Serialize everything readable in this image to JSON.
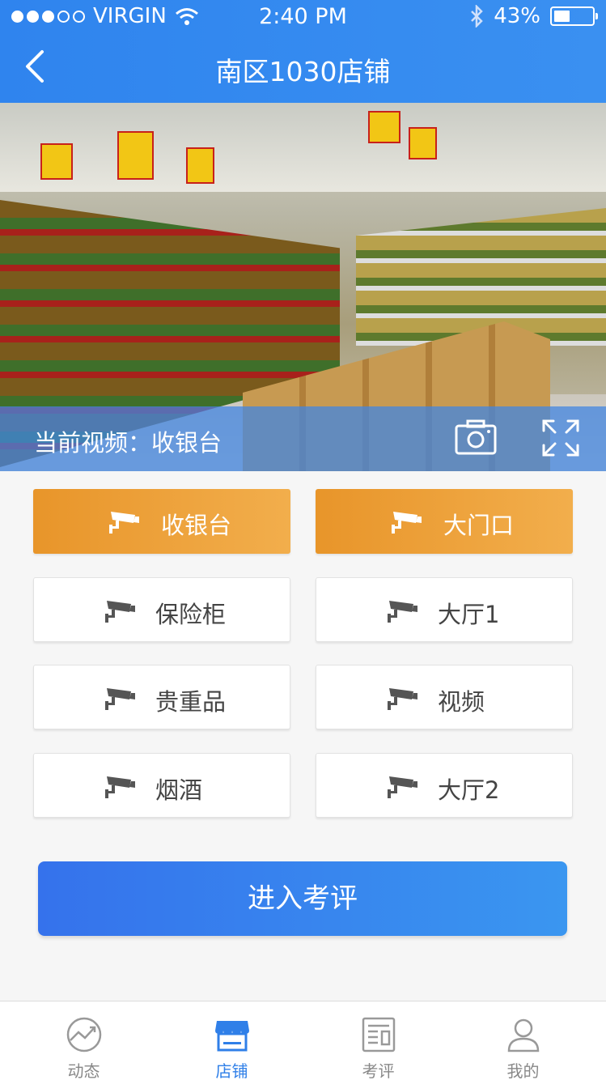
{
  "status_bar": {
    "carrier": "VIRGIN",
    "time": "2:40 PM",
    "battery": "43%",
    "battery_level": 0.43
  },
  "nav": {
    "title": "南区1030店铺",
    "back_icon": "chevron-left-icon"
  },
  "video": {
    "current_label": "当前视频：收银台",
    "snapshot_icon": "camera-icon",
    "fullscreen_icon": "fullscreen-icon"
  },
  "cameras": [
    {
      "label": "收银台",
      "active": true
    },
    {
      "label": "大门口",
      "active": true
    },
    {
      "label": "保险柜",
      "active": false
    },
    {
      "label": "大厅1",
      "active": false
    },
    {
      "label": "贵重品",
      "active": false
    },
    {
      "label": "视频",
      "active": false
    },
    {
      "label": "烟酒",
      "active": false
    },
    {
      "label": "大厅2",
      "active": false
    }
  ],
  "enter_button": "进入考评",
  "tabs": [
    {
      "label": "动态",
      "icon": "trend-icon",
      "active": false
    },
    {
      "label": "店铺",
      "icon": "store-icon",
      "active": true
    },
    {
      "label": "考评",
      "icon": "report-icon",
      "active": false
    },
    {
      "label": "我的",
      "icon": "user-icon",
      "active": false
    }
  ],
  "colors": {
    "primary": "#2f84ee",
    "active_orange": "#e8952a",
    "tab_active": "#2f7fe8"
  }
}
